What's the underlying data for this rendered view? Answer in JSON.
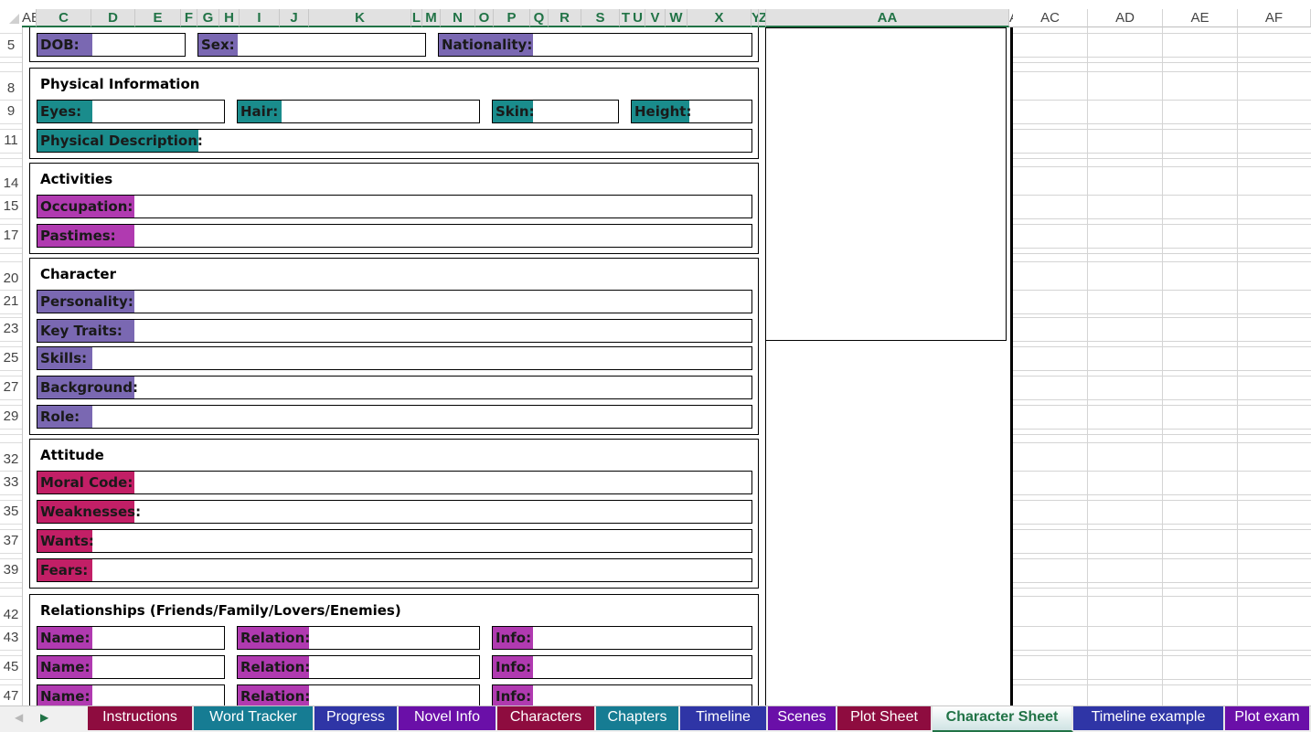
{
  "columns_selected": [
    "AE",
    "C",
    "D",
    "E",
    "F",
    "G",
    "H",
    "I",
    "J",
    "K",
    "L",
    "M",
    "N",
    "O",
    "P",
    "Q",
    "R",
    "S",
    "T",
    "U",
    "V",
    "W",
    "X",
    "Y",
    "Z",
    "AA"
  ],
  "columns_other": [
    "A",
    "AC",
    "AD",
    "AE",
    "AF"
  ],
  "rows": [
    "5",
    "8",
    "9",
    "11",
    "14",
    "15",
    "17",
    "20",
    "21",
    "23",
    "25",
    "27",
    "29",
    "32",
    "33",
    "35",
    "37",
    "39",
    "42",
    "43",
    "45",
    "47"
  ],
  "colors": {
    "header_accent": "#217346",
    "purple": "#7a68b2",
    "teal": "#1a8c8c",
    "magenta": "#b03ab0",
    "crimson": "#c21f66"
  },
  "basic": {
    "dob": {
      "label": "DOB:",
      "value": ""
    },
    "sex": {
      "label": "Sex:",
      "value": ""
    },
    "nationality": {
      "label": "Nationality:",
      "value": ""
    }
  },
  "physical": {
    "title": "Physical Information",
    "eyes": {
      "label": "Eyes:",
      "value": ""
    },
    "hair": {
      "label": "Hair:",
      "value": ""
    },
    "skin": {
      "label": "Skin:",
      "value": ""
    },
    "height": {
      "label": "Height:",
      "value": ""
    },
    "description": {
      "label": "Physical Description:",
      "value": ""
    }
  },
  "activities": {
    "title": "Activities",
    "occupation": {
      "label": "Occupation:",
      "value": ""
    },
    "pastimes": {
      "label": "Pastimes:",
      "value": ""
    }
  },
  "character": {
    "title": "Character",
    "personality": {
      "label": "Personality:",
      "value": ""
    },
    "key_traits": {
      "label": "Key Traits:",
      "value": ""
    },
    "skills": {
      "label": "Skills:",
      "value": ""
    },
    "background": {
      "label": "Background:",
      "value": ""
    },
    "role": {
      "label": "Role:",
      "value": ""
    }
  },
  "attitude": {
    "title": "Attitude",
    "moral_code": {
      "label": "Moral Code:",
      "value": ""
    },
    "weaknesses": {
      "label": "Weaknesses:",
      "value": ""
    },
    "wants": {
      "label": "Wants:",
      "value": ""
    },
    "fears": {
      "label": "Fears:",
      "value": ""
    }
  },
  "relationships": {
    "title": "Relationships (Friends/Family/Lovers/Enemies)",
    "name_label": "Name:",
    "relation_label": "Relation:",
    "info_label": "Info:"
  },
  "tabs": [
    {
      "label": "Instructions",
      "color": "#8e0c3f"
    },
    {
      "label": "Word Tracker",
      "color": "#167c93"
    },
    {
      "label": "Progress",
      "color": "#2f35a6"
    },
    {
      "label": "Novel Info",
      "color": "#6a0fa8"
    },
    {
      "label": "Characters",
      "color": "#8e0c3f"
    },
    {
      "label": "Chapters",
      "color": "#167c93"
    },
    {
      "label": "Timeline",
      "color": "#2f35a6"
    },
    {
      "label": "Scenes",
      "color": "#6a0fa8"
    },
    {
      "label": "Plot Sheet",
      "color": "#8e0c3f"
    },
    {
      "label": "Character Sheet",
      "color": "#ffffff",
      "active": true
    },
    {
      "label": "Timeline example",
      "color": "#2f35a6"
    },
    {
      "label": "Plot exam",
      "color": "#6a0fa8"
    }
  ]
}
